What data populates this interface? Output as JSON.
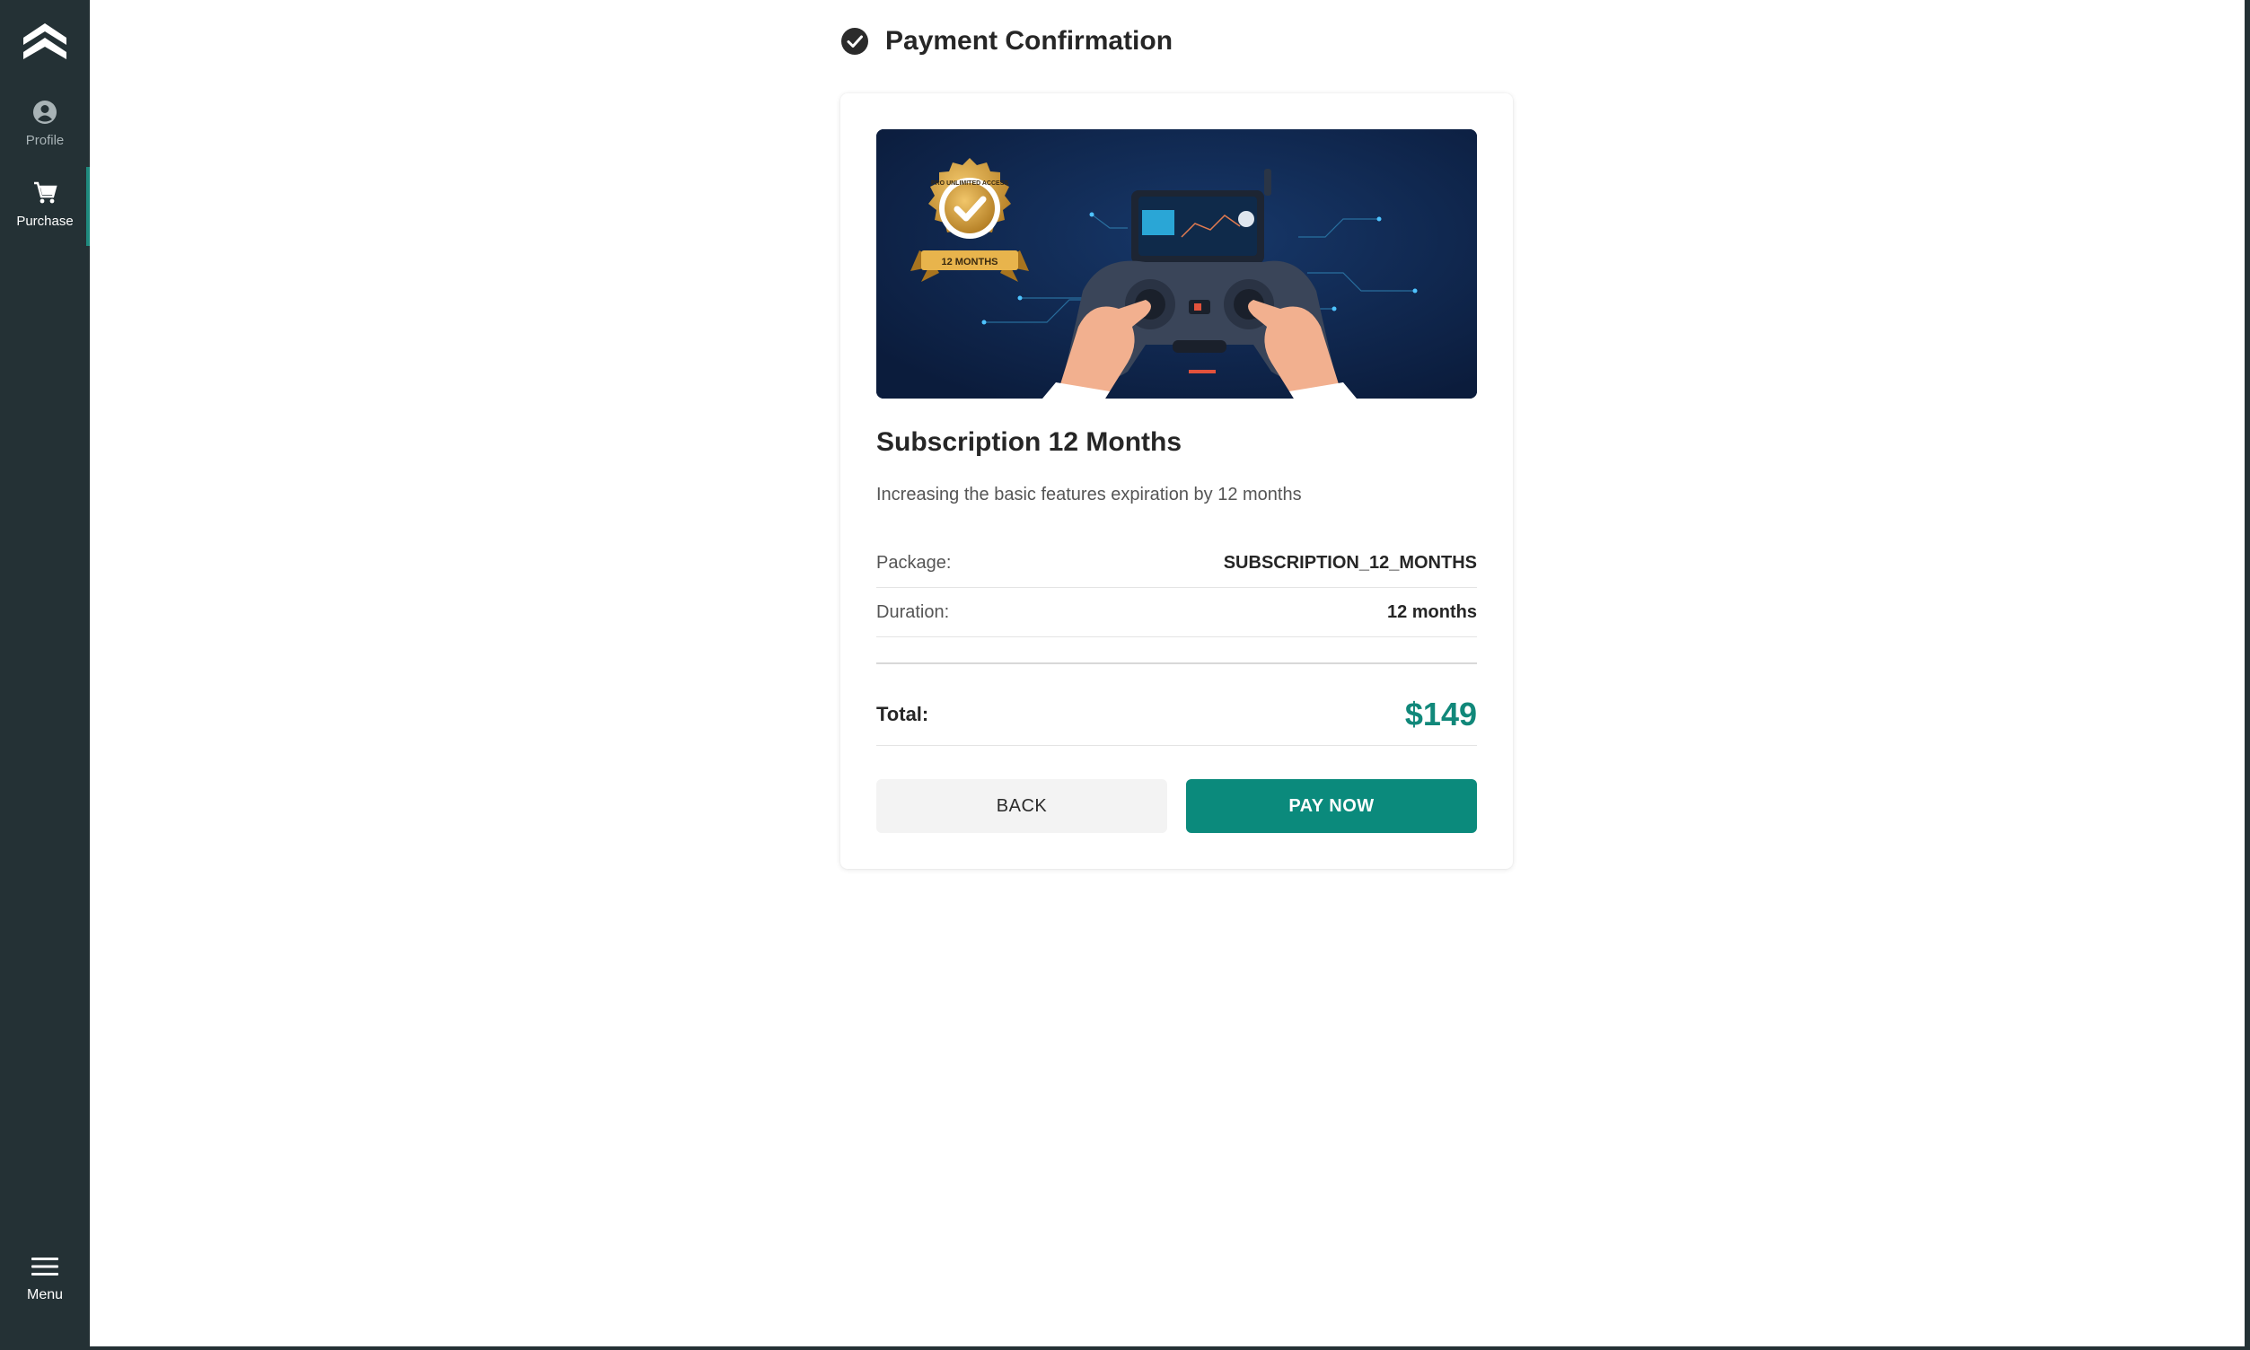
{
  "sidebar": {
    "items": [
      {
        "label": "Profile",
        "icon": "user-circle-icon"
      },
      {
        "label": "Purchase",
        "icon": "cart-icon",
        "active": true
      }
    ],
    "menu_label": "Menu"
  },
  "header": {
    "title": "Payment Confirmation",
    "icon": "check-circle-icon"
  },
  "product": {
    "banner": {
      "badge_top": "PRO UNLIMITED ACCESS",
      "badge_bottom": "12 MONTHS"
    },
    "title": "Subscription 12 Months",
    "description": "Increasing the basic features expiration by 12 months"
  },
  "details": {
    "package_label": "Package:",
    "package_value": "SUBSCRIPTION_12_MONTHS",
    "duration_label": "Duration:",
    "duration_value": "12 months",
    "total_label": "Total:",
    "total_value": "$149"
  },
  "actions": {
    "back_label": "BACK",
    "pay_label": "PAY NOW"
  },
  "colors": {
    "sidebar": "#243135",
    "accent": "#0b8a7c",
    "price": "#11887a"
  }
}
